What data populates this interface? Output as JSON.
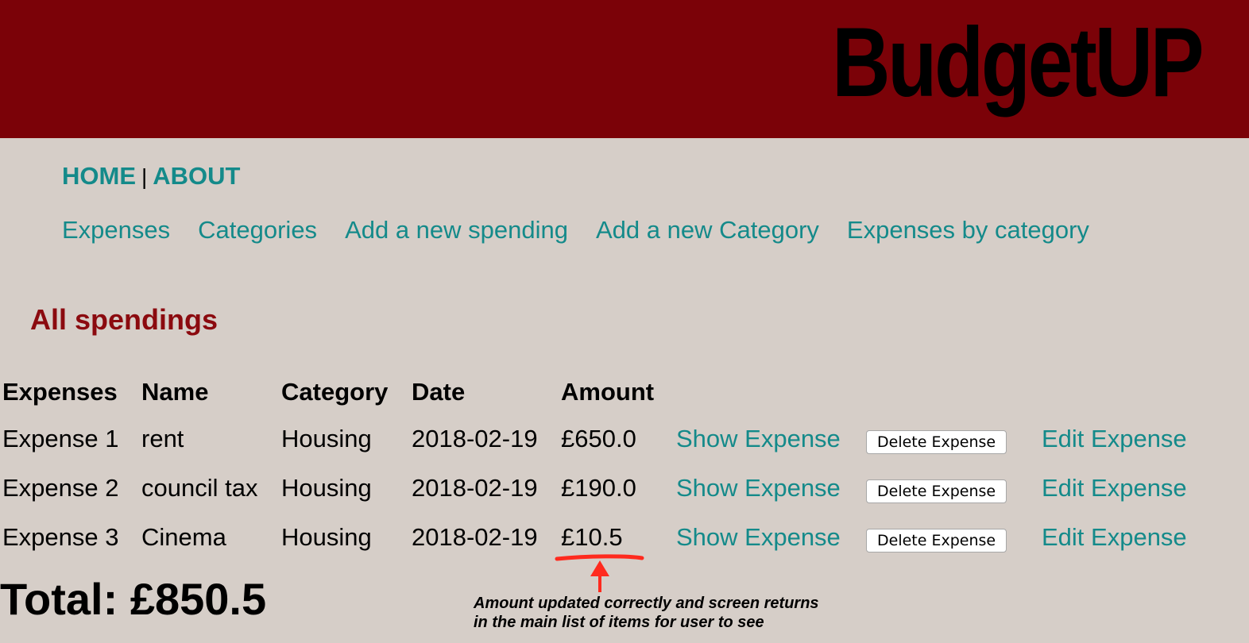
{
  "header": {
    "brand": "BudgetUP",
    "colors": {
      "header_bg": "#7b0208",
      "page_bg": "#d6cec8",
      "link": "#148a8a",
      "title": "#8b0a0f",
      "annotation": "#ff2a1e"
    }
  },
  "nav": {
    "home": "HOME",
    "separator": "|",
    "about": "ABOUT"
  },
  "subnav": [
    "Expenses",
    "Categories",
    "Add a new spending",
    "Add a new Category",
    "Expenses by category"
  ],
  "page_title": "All spendings",
  "table": {
    "headers": [
      "Expenses",
      "Name",
      "Category",
      "Date",
      "Amount"
    ],
    "rows": [
      {
        "label": "Expense 1",
        "name": "rent",
        "category": "Housing",
        "date": "2018-02-19",
        "amount": "£650.0",
        "show": "Show Expense",
        "delete": "Delete Expense",
        "edit": "Edit Expense"
      },
      {
        "label": "Expense 2",
        "name": "council tax",
        "category": "Housing",
        "date": "2018-02-19",
        "amount": "£190.0",
        "show": "Show Expense",
        "delete": "Delete Expense",
        "edit": "Edit Expense"
      },
      {
        "label": "Expense 3",
        "name": "Cinema",
        "category": "Housing",
        "date": "2018-02-19",
        "amount": "£10.5",
        "show": "Show Expense",
        "delete": "Delete Expense",
        "edit": "Edit Expense"
      }
    ]
  },
  "total": "Total: £850.5",
  "annotation": {
    "line1": "Amount updated correctly and screen returns",
    "line2": "in the main list of items for user to see"
  }
}
